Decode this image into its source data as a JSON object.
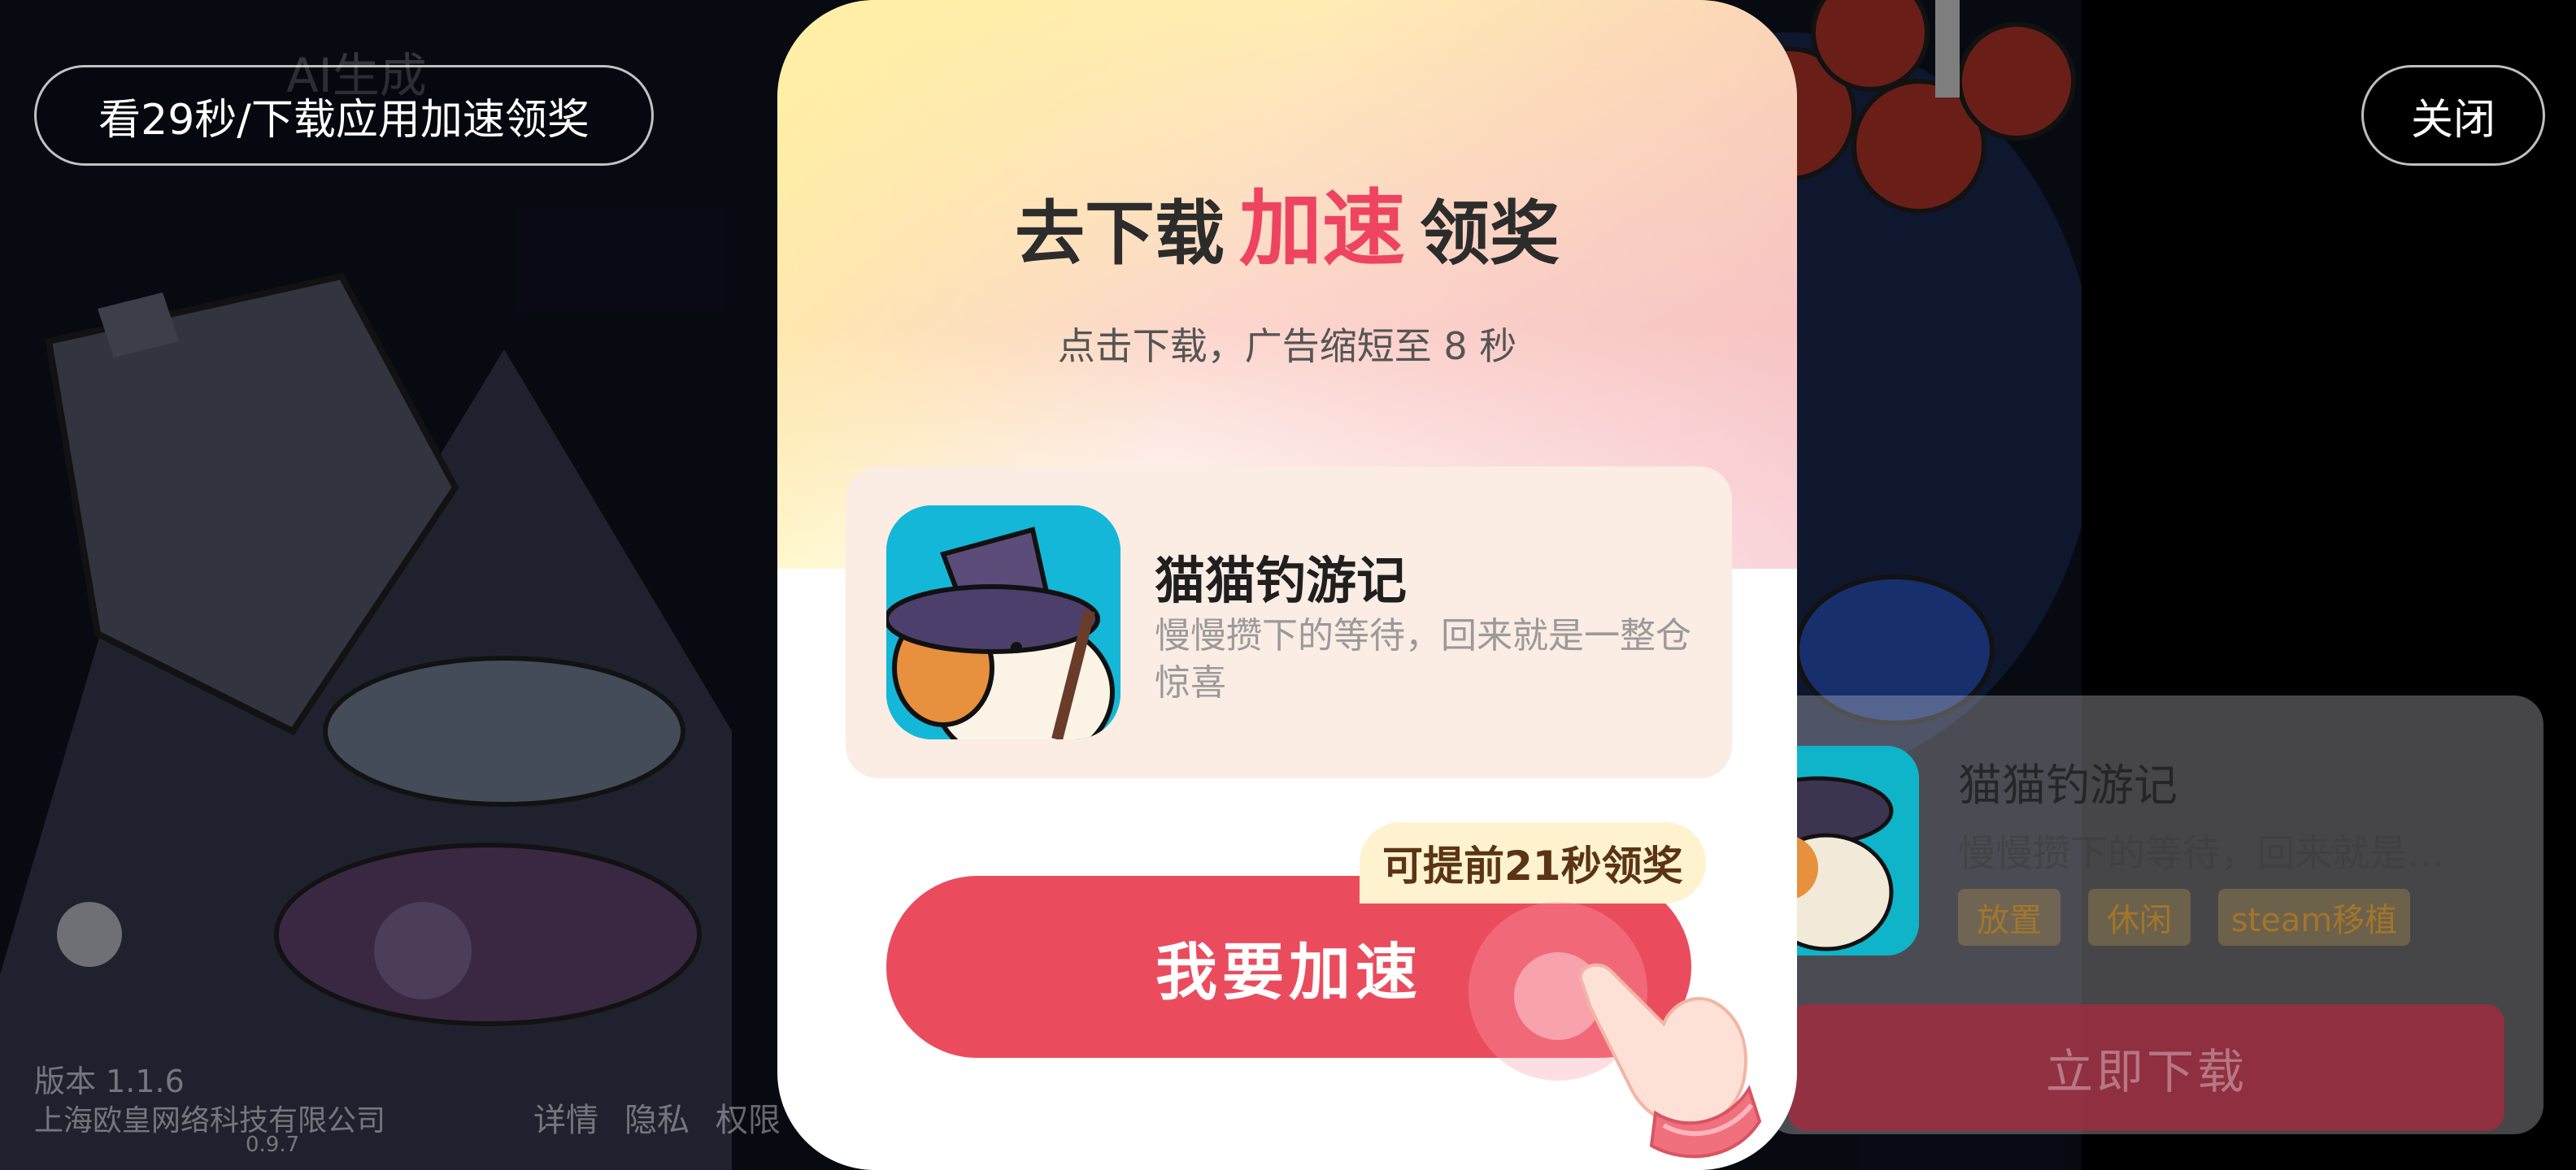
{
  "top_bar": {
    "timer_label": "看29秒/下载应用加速领奖",
    "close_label": "关闭",
    "ai_tag": "AI生成"
  },
  "footer": {
    "version": "版本 1.1.6",
    "company": "上海欧皇网络科技有限公司",
    "build": "0.9.7",
    "links": [
      "详情",
      "隐私",
      "权限"
    ]
  },
  "modal": {
    "headline_pre": "去下载",
    "headline_highlight": "加速",
    "headline_post": "领奖",
    "subline": "点击下载，广告缩短至 8 秒",
    "app_name": "猫猫钓游记",
    "app_desc": "慢慢攒下的等待，回来就是一整仓惊喜",
    "early_badge": "可提前21秒领奖",
    "cta_label": "我要加速"
  },
  "side_card": {
    "title": "猫猫钓游记",
    "desc": "慢慢攒下的等待，回来就是…",
    "tags": [
      "放置",
      "休闲",
      "steam移植"
    ],
    "download_label": "立即下载"
  },
  "colors": {
    "accent": "#ea4c5e",
    "highlight_text": "#ee4461",
    "badge_bg": "#fff3cf",
    "icon_bg": "#14b7d7"
  }
}
